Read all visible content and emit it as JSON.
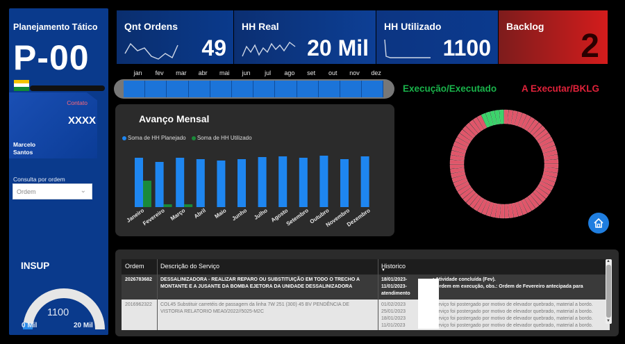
{
  "sidebar": {
    "title": "Planejamento Tático",
    "code": "P-00",
    "contact_label": "Contato",
    "contact_value": "XXXX",
    "contact_name_line1": "Marcelo",
    "contact_name_line2": "Santos",
    "query_label": "Consulta por ordem",
    "query_placeholder": "Ordem",
    "gauge_label": "INSUP",
    "gauge_value": "1100",
    "gauge_value_num": 1100,
    "gauge_min": "0 Mil",
    "gauge_max": "20 Mil",
    "gauge_max_num": 20000
  },
  "kpis": {
    "orders": {
      "title": "Qnt Ordens",
      "value": "49"
    },
    "hh_real": {
      "title": "HH Real",
      "value": "20 Mil"
    },
    "hh_used": {
      "title": "HH Utilizado",
      "value": "1100"
    },
    "backlog": {
      "title": "Backlog",
      "value": "2"
    }
  },
  "months": [
    "jan",
    "fev",
    "mar",
    "abr",
    "mai",
    "jun",
    "jul",
    "ago",
    "set",
    "out",
    "nov",
    "dez"
  ],
  "chart_title": "Avanço Mensal",
  "colors": {
    "planned": "#1e86f0",
    "used": "#1a8a3a",
    "exec": "#3bd36a",
    "backlog": "#e0566a",
    "accent": "#0a3a8c"
  },
  "chart_data": {
    "type": "bar",
    "categories": [
      "Janeiro",
      "Fevereiro",
      "Março",
      "Abril",
      "Maio",
      "Junho",
      "Julho",
      "Agosto",
      "Setembro",
      "Outubro",
      "Novembro",
      "Dezembro"
    ],
    "series": [
      {
        "name": "Soma de HH Planejado",
        "values": [
          71,
          65,
          71,
          69,
          67,
          69,
          72,
          73,
          71,
          74,
          69,
          73
        ]
      },
      {
        "name": "Soma de HH Utilizado",
        "values": [
          38,
          4,
          4,
          0,
          0,
          0,
          0,
          0,
          0,
          0,
          0,
          0
        ]
      }
    ],
    "legend_position": "top-left"
  },
  "donut": {
    "exec_label": "Execução/Executado",
    "backlog_label": "A Executar/BKLG",
    "exec_fraction": 0.07
  },
  "table": {
    "headers": [
      "Ordem",
      "Descrição do Serviço",
      "Historico"
    ],
    "rows": [
      {
        "ordem": "2026783682",
        "desc_line1": "DESSALINIZADORA - REALIZAR REPARO OU SUBSTITUIÇÃO EM TODO O TRECHO A",
        "desc_line2": "MONTANTE E A JUSANTE DA BOMBA EJETORA DA UNIDADE DESSALINIZADORA",
        "hist_dates": [
          "18/01/2023-",
          "11/01/2023-"
        ],
        "hist_texts": [
          ": Atividade concluída (Fev).",
          ": Ordem em execução, obs.: Ordem de Fevereiro antecipada para"
        ],
        "hist_extra": "atendimento"
      },
      {
        "ordem": "2016962322",
        "desc_line1": "COL45 Substituir carretéis de passagem da linha 7W 251 (300)    45   BV PENDÊNCIA DE",
        "desc_line2": "VISTORIA    RELATORIO MEA0/2022//5025-M2C",
        "hist_dates": [
          "01/02/2023",
          "25/01/2023",
          "18/01/2023",
          "11/01/2023"
        ],
        "hist_texts": [
          "Serviço foi postergado por motivo de elevador quebrado, material a bordo.",
          "Serviço foi postergado por motivo de elevador quebrado, material a bordo.",
          "Serviço foi postergado por motivo de elevador quebrado, material a bordo.",
          "Serviço foi postergado por motivo de elevador quebrado, material a bordo."
        ]
      }
    ]
  }
}
